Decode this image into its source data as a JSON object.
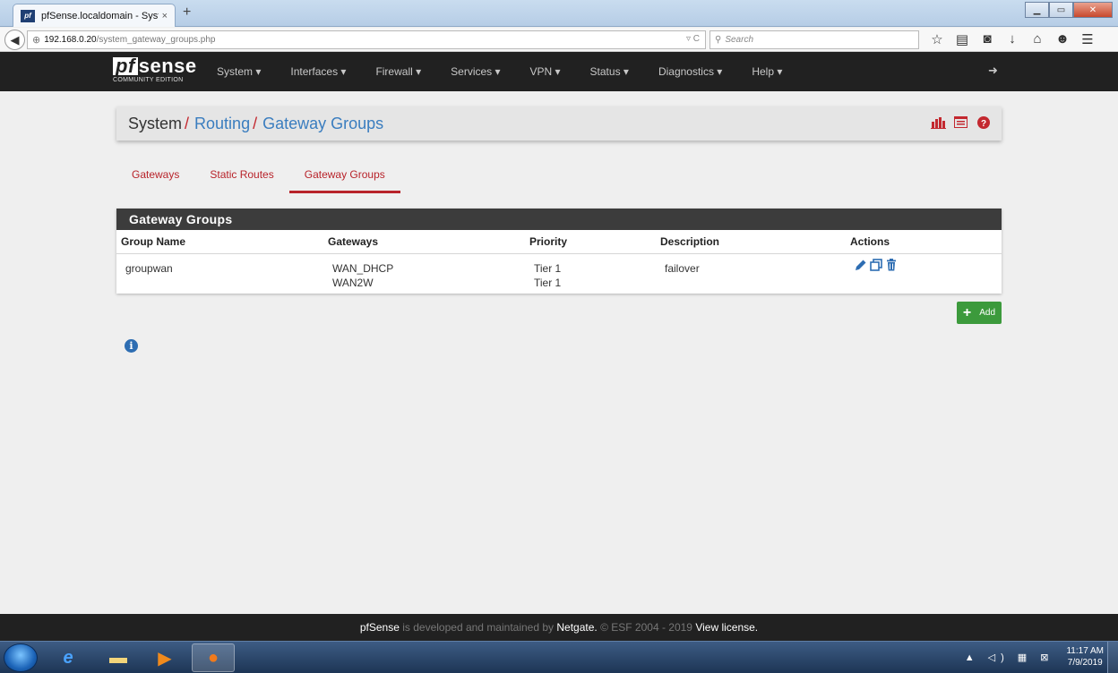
{
  "browser": {
    "tab_title": "pfSense.localdomain - Syst...",
    "tab_close": "×",
    "new_tab": "+",
    "url_host": "192.168.0.20",
    "url_path": "/system_gateway_groups.php",
    "search_placeholder": "Search"
  },
  "window_controls": {
    "minimize": "▁",
    "maximize": "▭",
    "close": "✕"
  },
  "logo": {
    "text_pf": "pf",
    "text_sense": "sense",
    "sub": "COMMUNITY EDITION"
  },
  "menu": {
    "system": "System ▾",
    "interfaces": "Interfaces ▾",
    "firewall": "Firewall ▾",
    "services": "Services ▾",
    "vpn": "VPN ▾",
    "status": "Status ▾",
    "diagnostics": "Diagnostics ▾",
    "help": "Help ▾"
  },
  "breadcrumb": {
    "root": "System",
    "sep": "/",
    "level1": "Routing",
    "level2": "Gateway Groups"
  },
  "tabs": {
    "gateways": "Gateways",
    "static_routes": "Static Routes",
    "gateway_groups": "Gateway Groups"
  },
  "panel": {
    "title": "Gateway Groups",
    "columns": [
      "Group Name",
      "Gateways",
      "Priority",
      "Description",
      "Actions"
    ],
    "rows": [
      {
        "group_name": "groupwan",
        "gateway_1": "WAN_DHCP",
        "gateway_2": "WAN2W",
        "priority_1": "Tier 1",
        "priority_2": "Tier 1",
        "description": "failover"
      }
    ]
  },
  "add_button": {
    "label": "Add"
  },
  "footer": {
    "brand": "pfSense",
    "text1": " is developed and maintained by ",
    "company": "Netgate.",
    "text2": " © ESF 2004 - 2019 ",
    "license": "View license."
  },
  "taskbar": {
    "time": "11:17 AM",
    "date": "7/9/2019"
  },
  "colors": {
    "accent_red": "#b8232a",
    "link_blue": "#3a7dbf",
    "header_dark": "#212121",
    "add_green": "#3c9a3c"
  }
}
